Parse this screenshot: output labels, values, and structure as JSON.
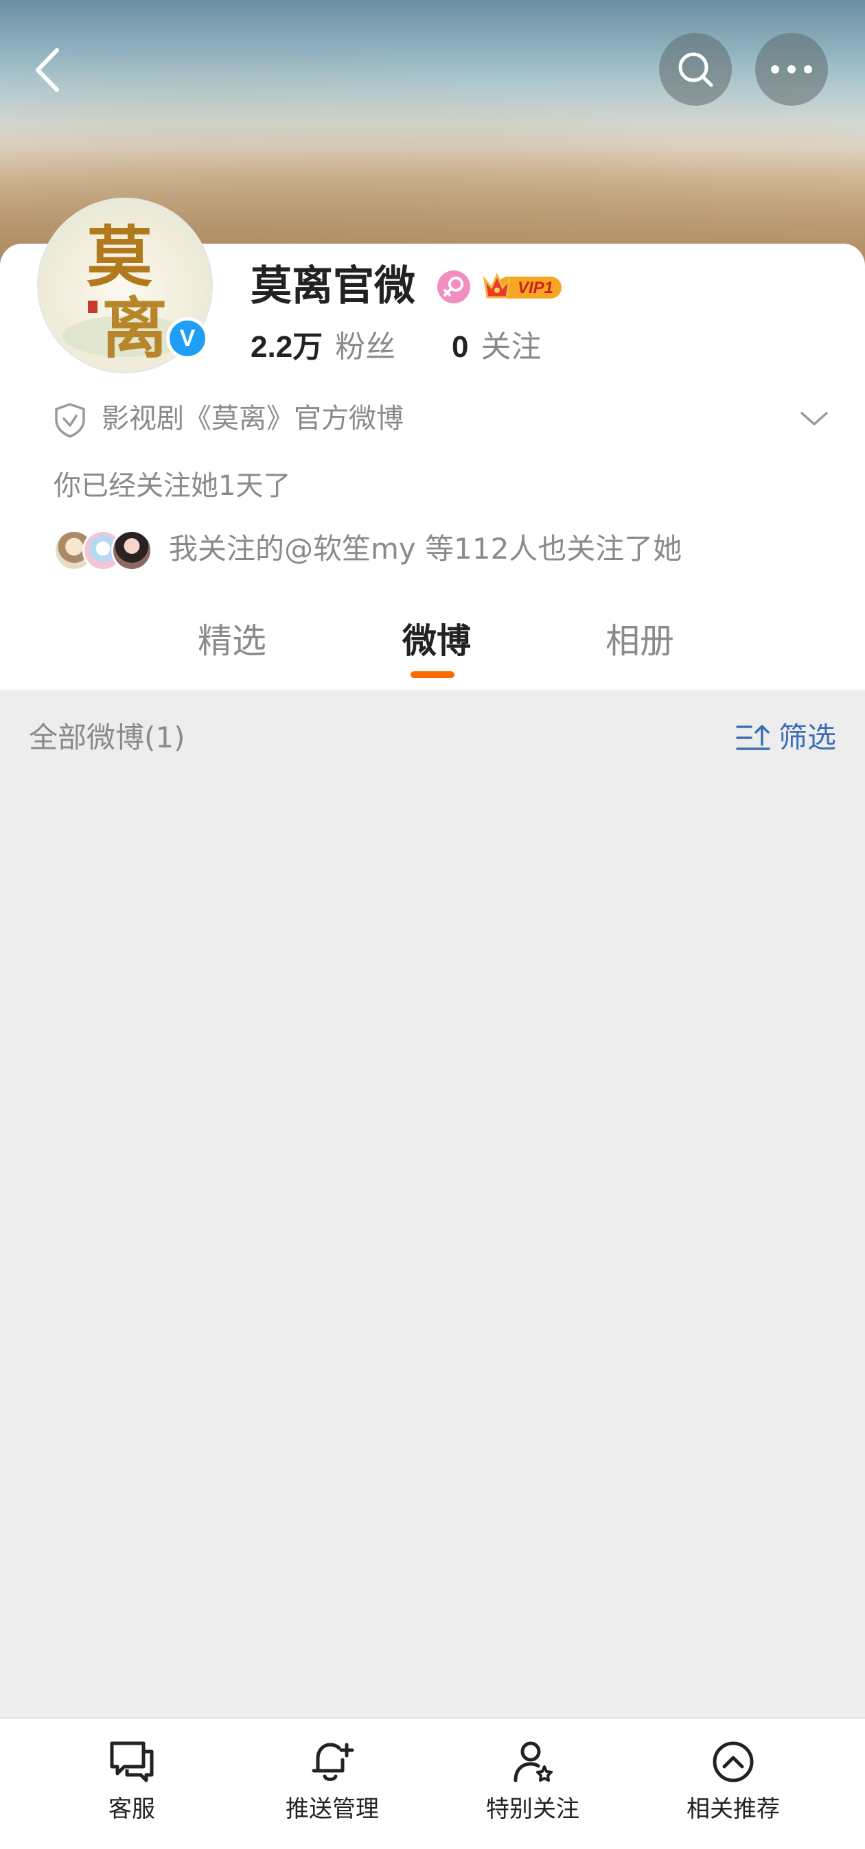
{
  "profile": {
    "name": "莫离官微",
    "avatar_text": "莫离",
    "vip_label": "VIP1",
    "fans_count": "2.2万",
    "fans_label": "粉丝",
    "following_count": "0",
    "following_label": "关注",
    "verification": "影视剧《莫离》官方微博",
    "followed_days": "你已经关注她1天了",
    "mutual_follow": "我关注的@软笙my 等112人也关注了她"
  },
  "tabs": [
    {
      "label": "精选",
      "active": false
    },
    {
      "label": "微博",
      "active": true
    },
    {
      "label": "相册",
      "active": false
    }
  ],
  "filter": {
    "all_posts": "全部微博(1)",
    "filter_label": "筛选"
  },
  "bottom_bar": {
    "items": [
      {
        "label": "客服",
        "icon": "chat-bubbles-icon"
      },
      {
        "label": "推送管理",
        "icon": "bell-plus-icon"
      },
      {
        "label": "特别关注",
        "icon": "user-star-icon"
      },
      {
        "label": "相关推荐",
        "icon": "circle-chevron-up-icon"
      }
    ]
  },
  "colors": {
    "accent_orange": "#ff6a00",
    "link_blue": "#3d6fb5",
    "verified_blue": "#1e9ef4",
    "background_gray": "#ededed"
  }
}
